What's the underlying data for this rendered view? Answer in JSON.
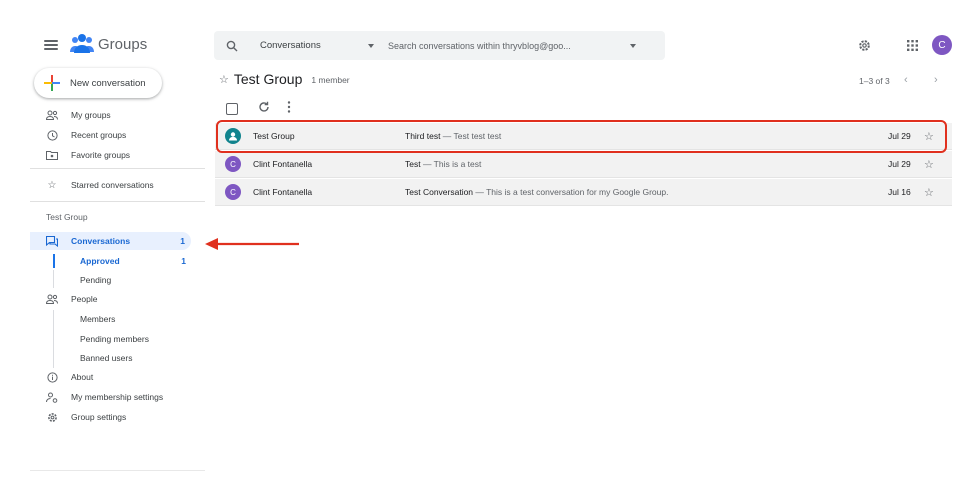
{
  "app": {
    "name": "Groups"
  },
  "sidebar": {
    "new_conversation": "New conversation",
    "main_items": [
      {
        "label": "My groups"
      },
      {
        "label": "Recent groups"
      },
      {
        "label": "Favorite groups"
      }
    ],
    "starred": "Starred conversations",
    "section_title": "Test Group",
    "conversations": {
      "label": "Conversations",
      "count": "1"
    },
    "conversation_sub": [
      {
        "label": "Approved",
        "count": "1"
      },
      {
        "label": "Pending"
      }
    ],
    "people": "People",
    "people_sub": [
      {
        "label": "Members"
      },
      {
        "label": "Pending members"
      },
      {
        "label": "Banned users"
      }
    ],
    "about": "About",
    "membership_settings": "My membership settings",
    "group_settings": "Group settings"
  },
  "search": {
    "scope": "Conversations",
    "placeholder": "Search conversations within thryvblog@goo..."
  },
  "user": {
    "avatar_letter": "C"
  },
  "group": {
    "title": "Test Group",
    "member_count": "1 member"
  },
  "pager": {
    "text": "1–3 of 3"
  },
  "conversations": [
    {
      "sender": "Test Group",
      "subject": "Third test",
      "snippet": " — Test test test",
      "date": "Jul 29",
      "avatar_letter": "",
      "avatar_type": "group"
    },
    {
      "sender": "Clint Fontanella",
      "subject": "Test",
      "snippet": " — This is a test",
      "date": "Jul 29",
      "avatar_letter": "C",
      "avatar_type": "user"
    },
    {
      "sender": "Clint Fontanella",
      "subject": "Test Conversation",
      "snippet": " — This is a test conversation for my Google Group.",
      "date": "Jul 16",
      "avatar_letter": "C",
      "avatar_type": "user"
    }
  ],
  "colors": {
    "accent_blue": "#1967d2",
    "highlight_red": "#e0301e",
    "avatar_purple": "#7e57c2",
    "group_avatar_teal": "#12848e"
  }
}
